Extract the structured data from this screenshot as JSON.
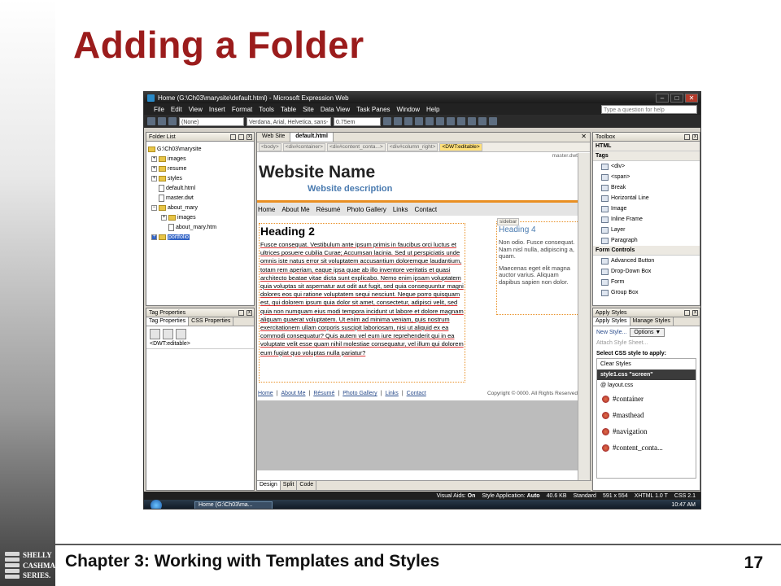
{
  "slide": {
    "title": "Adding a Folder",
    "footer": "Chapter 3: Working with Templates and Styles",
    "page_number": "17",
    "logo_lines": [
      "SHELLY",
      "CASHMAN",
      "SERIES."
    ]
  },
  "window": {
    "title": "Home (G:\\Ch03\\marysite\\default.html) - Microsoft Expression Web",
    "controls": [
      "–",
      "□",
      "✕"
    ]
  },
  "menu": [
    "File",
    "Edit",
    "View",
    "Insert",
    "Format",
    "Tools",
    "Table",
    "Site",
    "Data View",
    "Task Panes",
    "Window",
    "Help"
  ],
  "help_placeholder": "Type a question for help",
  "toolbar": {
    "style": "(None)",
    "font": "Verdana, Arial, Helvetica, sans-",
    "size": "0.75em"
  },
  "folder_list": {
    "title": "Folder List",
    "items": [
      {
        "label": "G:\\Ch03\\marysite",
        "type": "folder",
        "depth": 0,
        "toggle": ""
      },
      {
        "label": "images",
        "type": "folder",
        "depth": 1,
        "toggle": "+"
      },
      {
        "label": "resume",
        "type": "folder",
        "depth": 1,
        "toggle": "+"
      },
      {
        "label": "styles",
        "type": "folder",
        "depth": 1,
        "toggle": "+"
      },
      {
        "label": "default.html",
        "type": "file",
        "depth": 1,
        "toggle": ""
      },
      {
        "label": "master.dwt",
        "type": "file",
        "depth": 1,
        "toggle": ""
      },
      {
        "label": "about_mary",
        "type": "folder",
        "depth": 1,
        "toggle": "−"
      },
      {
        "label": "images",
        "type": "folder",
        "depth": 2,
        "toggle": "+"
      },
      {
        "label": "about_mary.htm",
        "type": "file",
        "depth": 2,
        "toggle": ""
      },
      {
        "label": "portfolio",
        "type": "folder",
        "depth": 1,
        "toggle": "+",
        "selected": true
      }
    ]
  },
  "tag_properties": {
    "title": "Tag Properties",
    "tabs": [
      "Tag Properties",
      "CSS Properties"
    ],
    "tag": "<DWT:editable>"
  },
  "document": {
    "tabs": [
      "Web Site",
      "default.html"
    ],
    "breadcrumbs": [
      "<body>",
      "<div#container>",
      "<div#content_conta...>",
      "<div#column_right>",
      "<DWT:editable>"
    ],
    "master_label": "master.dwt",
    "site_name": "Website Name",
    "site_description": "Website description",
    "nav": [
      "Home",
      "About Me",
      "Résumé",
      "Photo Gallery",
      "Links",
      "Contact"
    ],
    "heading": "Heading 2",
    "body_text": "Fusce consequat. Vestibulum ante ipsum primis in faucibus orci luctus et ultrices posuere cubilia Curae; Accumsan lacinia. Sed ut perspiciatis unde omnis iste natus error sit voluptatem accusantium doloremque laudantium, totam rem aperiam, eaque ipsa quae ab illo inventore veritatis et quasi architecto beatae vitae dicta sunt explicabo. Nemo enim ipsam voluptatem quia voluptas sit aspernatur aut odit aut fugit, sed quia consequuntur magni dolores eos qui ratione voluptatem sequi nesciunt. Neque porro quisquam est, qui dolorem ipsum quia dolor sit amet, consectetur, adipisci velit, sed quia non numquam eius modi tempora incidunt ut labore et dolore magnam aliquam quaerat voluptatem. Ut enim ad minima veniam, quis nostrum exercitationem ullam corporis suscipit laboriosam, nisi ut aliquid ex ea commodi consequatur? Quis autem vel eum iure reprehenderit qui in ea voluptate velit esse quam nihil molestiae consequatur, vel illum qui dolorem eum fugiat quo voluptas nulla pariatur?",
    "sidebar_tag": "sidebar",
    "sidebar_heading": "Heading 4",
    "sidebar_p1": "Non odio. Fusce consequat. Nam nisl nulla, adipiscing a, quam.",
    "sidebar_p2": "Maecenas eget elit magna auctor varius. Aliquam dapibus sapien non dolor.",
    "footer_links": [
      "Home",
      "About Me",
      "Résumé",
      "Photo Gallery",
      "Links",
      "Contact"
    ],
    "footer_copyright": "Copyright © 0000. All Rights Reserved",
    "view_tabs": [
      "Design",
      "Split",
      "Code"
    ]
  },
  "toolbox": {
    "title": "Toolbox",
    "groups": [
      {
        "name": "HTML",
        "items": []
      },
      {
        "name": "Tags",
        "items": [
          "<div>",
          "<span>",
          "Break",
          "Horizontal Line",
          "Image",
          "Inline Frame",
          "Layer",
          "Paragraph"
        ]
      },
      {
        "name": "Form Controls",
        "items": [
          "Advanced Button",
          "Drop-Down Box",
          "Form",
          "Group Box"
        ]
      }
    ]
  },
  "apply_styles": {
    "title": "Apply Styles",
    "tabs": [
      "Apply Styles",
      "Manage Styles"
    ],
    "new_style": "New Style...",
    "options": "Options ▼",
    "attach": "Attach Style Sheet...",
    "select_label": "Select CSS style to apply:",
    "clear": "Clear Styles",
    "sheet_header": "style1.css \"screen\"",
    "sheet_file": "@ layout.css",
    "selectors": [
      "#container",
      "#masthead",
      "#navigation",
      "#content_conta..."
    ]
  },
  "status": {
    "visual_aids_label": "Visual Aids:",
    "visual_aids": "On",
    "style_app_label": "Style Application:",
    "style_app": "Auto",
    "size": "40.6 KB",
    "mode": "Standard",
    "dims": "591 x 554",
    "doctype": "XHTML 1.0 T",
    "css": "CSS 2.1"
  },
  "taskbar": {
    "app": "Home (G:\\Ch03\\ma...",
    "time": "10:47 AM"
  }
}
